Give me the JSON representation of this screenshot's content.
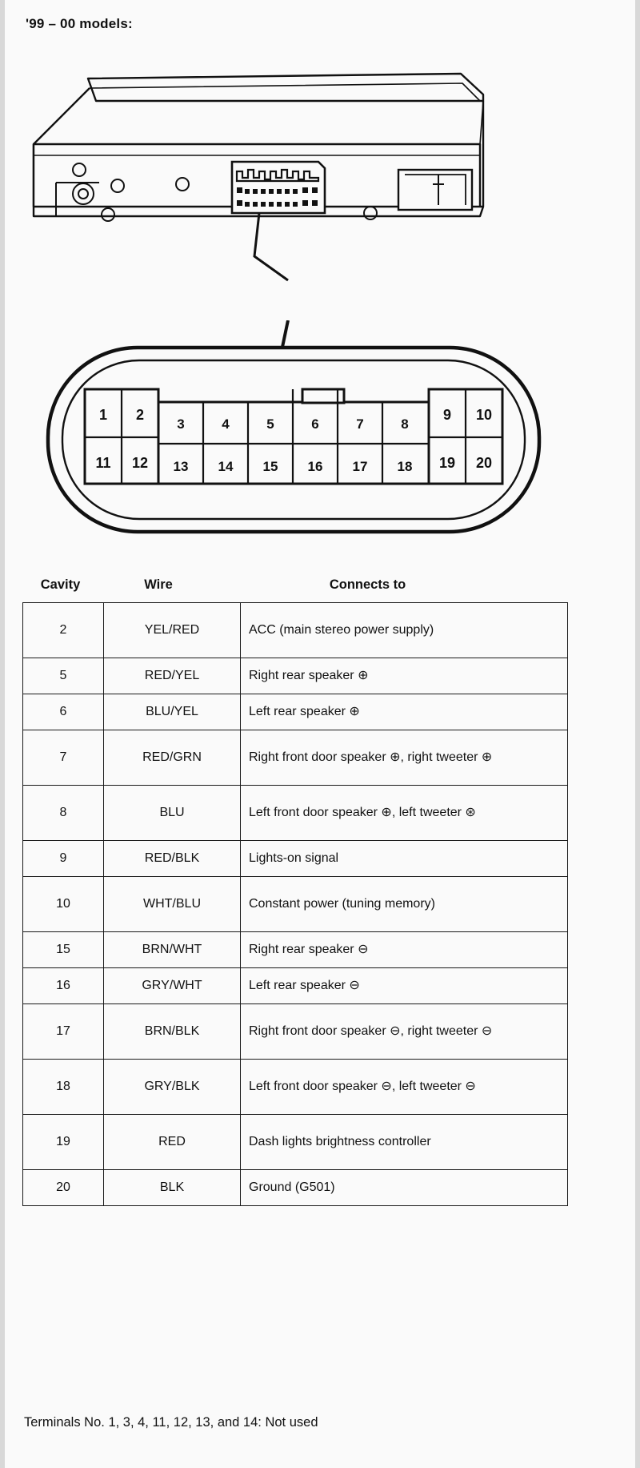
{
  "heading": "'99 – 00 models:",
  "diagram": {
    "unit_label": "car-stereo-rear-view",
    "connector_label": "20-pin-connector-closeup",
    "pins_top": [
      "1",
      "2",
      "3",
      "4",
      "5",
      "6",
      "7",
      "8",
      "9",
      "10"
    ],
    "pins_bottom": [
      "11",
      "12",
      "13",
      "14",
      "15",
      "16",
      "17",
      "18",
      "19",
      "20"
    ]
  },
  "table": {
    "headers": {
      "cavity": "Cavity",
      "wire": "Wire",
      "connects": "Connects to"
    },
    "rows": [
      {
        "cavity": "2",
        "wire": "YEL/RED",
        "connects": "ACC (main stereo power supply)",
        "tall": true
      },
      {
        "cavity": "5",
        "wire": "RED/YEL",
        "connects": "Right rear speaker ⊕",
        "tall": false
      },
      {
        "cavity": "6",
        "wire": "BLU/YEL",
        "connects": "Left rear speaker ⊕",
        "tall": false
      },
      {
        "cavity": "7",
        "wire": "RED/GRN",
        "connects": "Right front door speaker ⊕, right tweeter ⊕",
        "tall": true
      },
      {
        "cavity": "8",
        "wire": "BLU",
        "connects": "Left front door speaker ⊕, left tweeter ⊛",
        "tall": true
      },
      {
        "cavity": "9",
        "wire": "RED/BLK",
        "connects": "Lights-on signal",
        "tall": false
      },
      {
        "cavity": "10",
        "wire": "WHT/BLU",
        "connects": "Constant power (tuning memory)",
        "tall": true
      },
      {
        "cavity": "15",
        "wire": "BRN/WHT",
        "connects": "Right rear speaker ⊖",
        "tall": false
      },
      {
        "cavity": "16",
        "wire": "GRY/WHT",
        "connects": "Left rear speaker ⊖",
        "tall": false
      },
      {
        "cavity": "17",
        "wire": "BRN/BLK",
        "connects": "Right front door speaker ⊖, right tweeter ⊖",
        "tall": true
      },
      {
        "cavity": "18",
        "wire": "GRY/BLK",
        "connects": "Left front door speaker ⊖, left tweeter ⊖",
        "tall": true
      },
      {
        "cavity": "19",
        "wire": "RED",
        "connects": "Dash lights brightness controller",
        "tall": true
      },
      {
        "cavity": "20",
        "wire": "BLK",
        "connects": "Ground (G501)",
        "tall": false
      }
    ]
  },
  "footnote": "Terminals No. 1, 3, 4, 11, 12, 13, and 14: Not used"
}
